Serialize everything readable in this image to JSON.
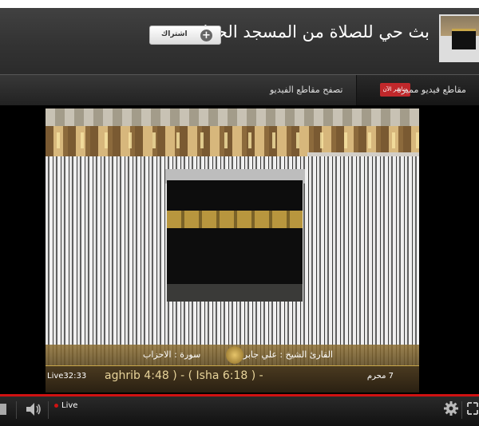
{
  "header": {
    "channel_title": "بث حي للصلاة من المسجد الحرام",
    "subscribe_label": "اشتراك",
    "thumbnail_icon": "kaaba-thumbnail"
  },
  "nav": {
    "featured_label": "مقاطع فيديو مميزة",
    "live_badge": "مباشر الآن",
    "browse_label": "تصفح مقاطع الفيديو"
  },
  "video": {
    "reciter": "القارئ الشيخ : علي جابر",
    "surah": "سورة : الاحزاب",
    "live_time": "Live32:33",
    "prayer_times": "aghrib 4:48 ) - ( Isha 6:18 ) -",
    "hijri_date": "7 محرم"
  },
  "controls": {
    "live_label": "Live",
    "icons": [
      "stop-icon",
      "volume-icon",
      "gear-icon",
      "fullscreen-icon"
    ]
  },
  "colors": {
    "accent_red": "#d01212",
    "badge_red": "#c0282b",
    "header_bg": "#333333"
  }
}
